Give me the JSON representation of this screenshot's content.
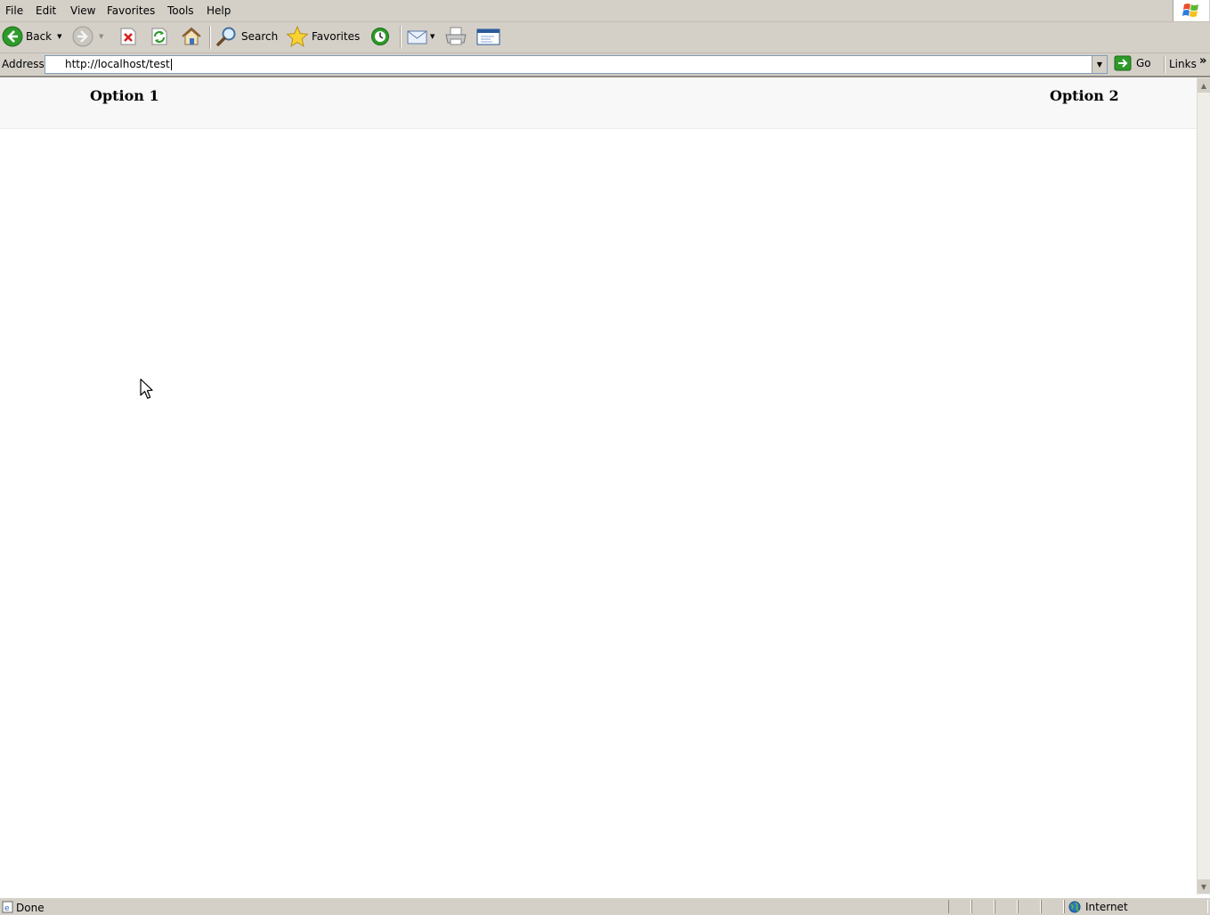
{
  "menu": {
    "items": [
      "File",
      "Edit",
      "View",
      "Favorites",
      "Tools",
      "Help"
    ]
  },
  "toolbar": {
    "back_label": "Back",
    "search_label": "Search",
    "favorites_label": "Favorites"
  },
  "address": {
    "label": "Address",
    "url": "http://localhost/test",
    "go_label": "Go",
    "links_label": "Links"
  },
  "page": {
    "options": [
      "Option 1",
      "Option 2"
    ]
  },
  "status": {
    "text": "Done",
    "zone": "Internet"
  },
  "colors": {
    "chrome": "#d4d0c8",
    "nav_strip": "#f8f8f8",
    "back_green": "#2e9a2a"
  }
}
